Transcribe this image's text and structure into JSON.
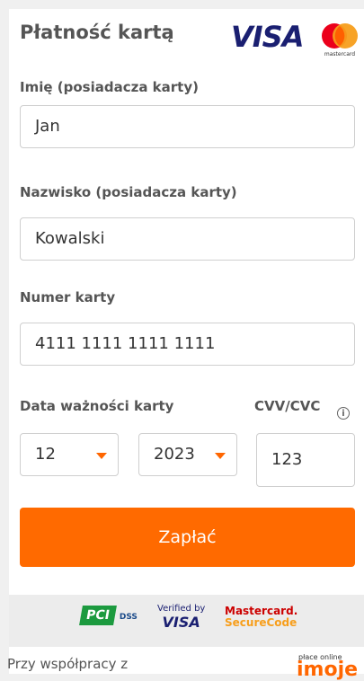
{
  "header": {
    "title": "Płatność kartą",
    "visa_text": "VISA",
    "mastercard_text": "mastercard"
  },
  "form": {
    "first_name": {
      "label": "Imię (posiadacza karty)",
      "value": "Jan"
    },
    "last_name": {
      "label": "Nazwisko (posiadacza karty)",
      "value": "Kowalski"
    },
    "card_number": {
      "label": "Numer karty",
      "value": "4111 1111 1111 1111"
    },
    "expiry": {
      "label": "Data ważności karty",
      "month": "12",
      "year": "2023"
    },
    "cvv": {
      "label": "CVV/CVC",
      "value": "123",
      "info_icon": "i"
    }
  },
  "pay_button": {
    "label": "Zapłać"
  },
  "badges": {
    "pci_main": "PCI",
    "pci_dss": "DSS",
    "verified_line1": "Verified by",
    "verified_line2": "VISA",
    "mc_line1": "Mastercard.",
    "mc_line2": "SecureCode"
  },
  "footer": {
    "text": "Przy współpracy z",
    "imoje_small": "płace online",
    "imoje_big": "imoje"
  },
  "colors": {
    "accent": "#ff6a00",
    "visa_blue": "#1a1f71"
  }
}
